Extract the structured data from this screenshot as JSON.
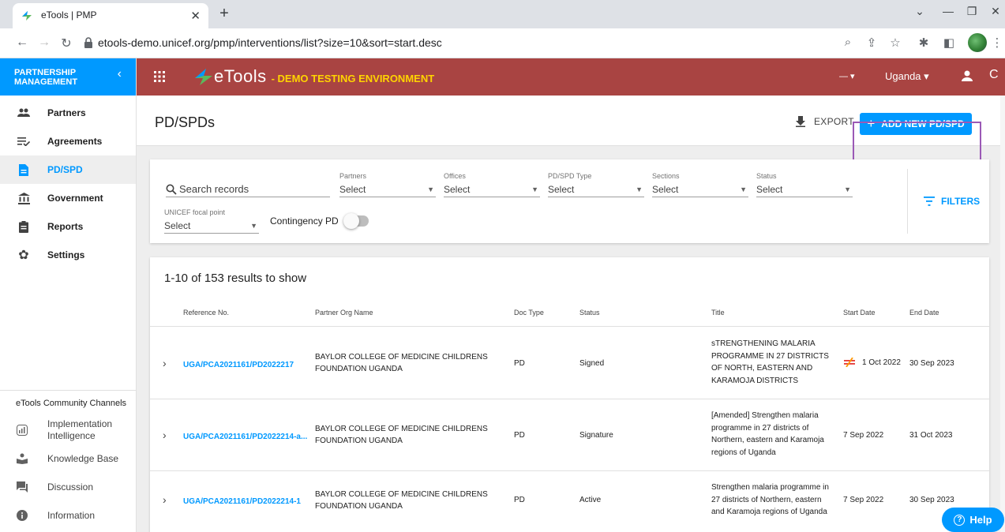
{
  "browser": {
    "tab_title": "eTools | PMP",
    "url": "etools-demo.unicef.org/pmp/interventions/list?size=10&sort=start.desc"
  },
  "sidebar": {
    "header": "PARTNERSHIP MANAGEMENT",
    "items": [
      {
        "label": "Partners",
        "icon": "people-icon"
      },
      {
        "label": "Agreements",
        "icon": "agreements-icon"
      },
      {
        "label": "PD/SPD",
        "icon": "document-icon"
      },
      {
        "label": "Government",
        "icon": "government-icon"
      },
      {
        "label": "Reports",
        "icon": "reports-icon"
      },
      {
        "label": "Settings",
        "icon": "gear-icon"
      }
    ],
    "active_item": "PD/SPD",
    "community_header": "eTools Community Channels",
    "community": [
      {
        "label": "Implementation Intelligence",
        "icon": "implementation-icon"
      },
      {
        "label": "Knowledge Base",
        "icon": "knowledge-icon"
      },
      {
        "label": "Discussion",
        "icon": "discussion-icon"
      },
      {
        "label": "Information",
        "icon": "info-icon"
      }
    ]
  },
  "appbar": {
    "logo": "eTools",
    "environment": "- DEMO TESTING ENVIRONMENT",
    "country": "Uganda"
  },
  "page": {
    "title": "PD/SPDs",
    "export_label": "EXPORT",
    "add_label": "ADD NEW PD/SPD"
  },
  "filters": {
    "search_placeholder": "Search records",
    "selects": [
      {
        "label": "Partners",
        "value": "Select"
      },
      {
        "label": "Offices",
        "value": "Select"
      },
      {
        "label": "PD/SPD Type",
        "value": "Select"
      },
      {
        "label": "Sections",
        "value": "Select"
      },
      {
        "label": "Status",
        "value": "Select"
      }
    ],
    "focal_point": {
      "label": "UNICEF focal point",
      "value": "Select"
    },
    "contingency_label": "Contingency PD",
    "filters_label": "FILTERS"
  },
  "results": {
    "count_text": "1-10 of 153 results to show",
    "columns": [
      "Reference No.",
      "Partner Org Name",
      "Doc Type",
      "Status",
      "Title",
      "Start Date",
      "End Date"
    ],
    "rows": [
      {
        "ref": "UGA/PCA2021161/PD2022217",
        "partner": "BAYLOR COLLEGE OF MEDICINE CHILDRENS FOUNDATION UGANDA",
        "doc_type": "PD",
        "status": "Signed",
        "title": "sTRENGTHENING MALARIA PROGRAMME IN 27 DISTRICTS OF NORTH, EASTERN AND KARAMOJA DISTRICTS",
        "start": "1 Oct 2022",
        "end": "30 Sep 2023",
        "warning": true
      },
      {
        "ref": "UGA/PCA2021161/PD2022214-a...",
        "partner": "BAYLOR COLLEGE OF MEDICINE CHILDRENS FOUNDATION UGANDA",
        "doc_type": "PD",
        "status": "Signature",
        "title": "[Amended] Strengthen malaria programme in 27 districts of Northern, eastern and Karamoja regions of Uganda",
        "start": "7 Sep 2022",
        "end": "31 Oct 2023",
        "warning": false
      },
      {
        "ref": "UGA/PCA2021161/PD2022214-1",
        "partner": "BAYLOR COLLEGE OF MEDICINE CHILDRENS FOUNDATION UGANDA",
        "doc_type": "PD",
        "status": "Active",
        "title": "Strengthen malaria programme in 27 districts of Northern, eastern and Karamoja regions of Uganda",
        "start": "7 Sep 2022",
        "end": "30 Sep 2023",
        "warning": false
      }
    ]
  },
  "help_label": "Help",
  "colors": {
    "accent": "#0099ff",
    "appbar": "#a94442",
    "env_text": "#ffd400",
    "highlight": "#9b59b6"
  }
}
